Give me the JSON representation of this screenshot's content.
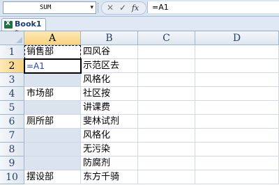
{
  "formula_bar": {
    "name_box_value": "SUM",
    "name_box_arrow": "▾",
    "cancel_icon": "✕",
    "enter_icon": "✓",
    "fx_label": "fx",
    "formula": "=A1"
  },
  "workbook_tab": {
    "label": "Book1 *",
    "icon": "excel-workbook-icon"
  },
  "columns": [
    "A",
    "B",
    "C",
    "D"
  ],
  "rows": [
    "1",
    "2",
    "3",
    "4",
    "5",
    "6",
    "7",
    "8",
    "9",
    "10"
  ],
  "cells": {
    "A1": "销售部",
    "A2": "=A1",
    "A4": "市场部",
    "A6": "厕所部",
    "A10": "摆设部",
    "B1": "四风谷",
    "B2": "示范区去",
    "B3": "风格化",
    "B4": "社区按",
    "B5": "讲课费",
    "B6": "斐林试剂",
    "B7": "风格化",
    "B8": "无污染",
    "B9": "防腐剂",
    "B10": "东方千骑"
  },
  "colors": {
    "formula_text": "#1f3fd0",
    "selected_header": "#f9d27f",
    "blank_cell_fill": "#dbe4ee"
  }
}
